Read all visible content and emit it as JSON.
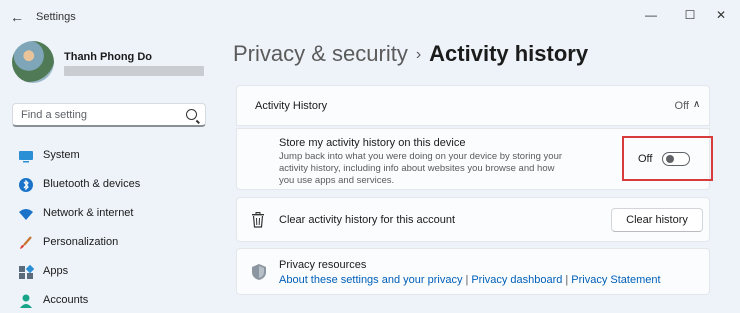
{
  "window": {
    "title": "Settings",
    "back_icon": "←",
    "minimize_icon": "—",
    "maximize_icon": "☐",
    "close_icon": "✕"
  },
  "user": {
    "name": "Thanh Phong Do"
  },
  "search": {
    "placeholder": "Find a setting"
  },
  "sidebar": {
    "items": [
      {
        "label": "System",
        "icon": "monitor-icon"
      },
      {
        "label": "Bluetooth & devices",
        "icon": "bluetooth-icon"
      },
      {
        "label": "Network & internet",
        "icon": "wifi-icon"
      },
      {
        "label": "Personalization",
        "icon": "brush-icon"
      },
      {
        "label": "Apps",
        "icon": "apps-grid-icon"
      },
      {
        "label": "Accounts",
        "icon": "person-icon"
      }
    ]
  },
  "breadcrumb": {
    "parent": "Privacy & security",
    "separator": "›",
    "current": "Activity history"
  },
  "activity_history": {
    "title": "Activity History",
    "status": "Off",
    "chevron": "∧",
    "store": {
      "title": "Store my activity history on this device",
      "description": "Jump back into what you were doing on your device by storing your activity history, including info about websites you browse and how you use apps and services.",
      "toggle_label": "Off",
      "toggle_on": false
    }
  },
  "clear": {
    "label": "Clear activity history for this account",
    "button": "Clear history"
  },
  "resources": {
    "title": "Privacy resources",
    "links": [
      "About these settings and your privacy",
      "Privacy dashboard",
      "Privacy Statement"
    ],
    "separator": "|"
  },
  "colors": {
    "accent": "#005fb8",
    "highlight_border": "#d83b3b",
    "background": "#eef3f9"
  }
}
